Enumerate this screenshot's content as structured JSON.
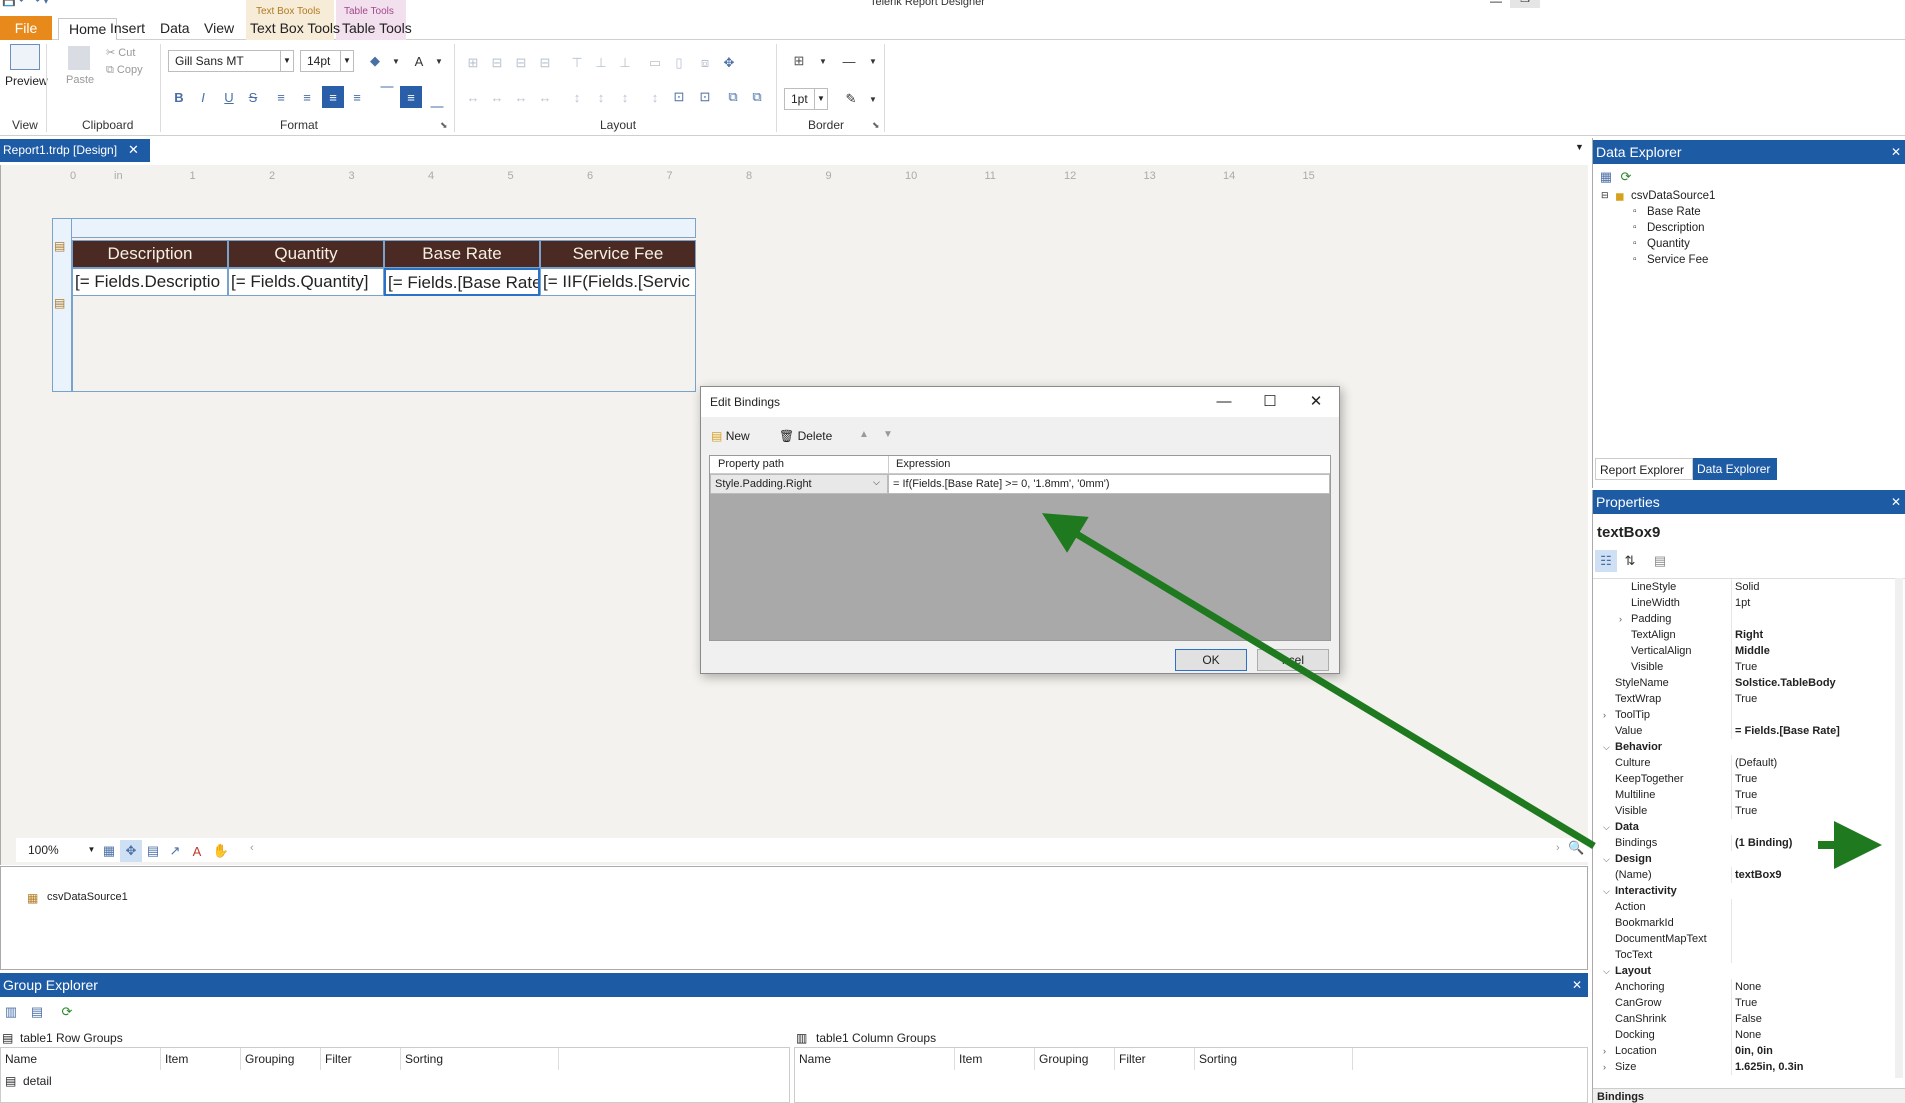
{
  "app": {
    "title": "Telerik Report Designer"
  },
  "ribbon": {
    "tabs": [
      {
        "label": "File"
      },
      {
        "label": "Home"
      },
      {
        "label": "Insert"
      },
      {
        "label": "Data"
      },
      {
        "label": "View"
      },
      {
        "label": "Text Box Tools"
      },
      {
        "label": "Table Tools"
      }
    ],
    "contextual": {
      "textbox_tools": "Text Box Tools",
      "table_tools": "Table Tools"
    },
    "preview_label": "Preview",
    "paste_label": "Paste",
    "cut_label": "Cut",
    "copy_label": "Copy",
    "font_family": "Gill Sans MT",
    "font_size": "14pt",
    "border_width": "1pt",
    "groups": {
      "view": "View",
      "clipboard": "Clipboard",
      "format": "Format",
      "layout": "Layout",
      "border": "Border"
    }
  },
  "document_tab": {
    "label": "Report1.trdp [Design]"
  },
  "ruler": {
    "marks": [
      "0",
      "in",
      "1",
      "2",
      "3",
      "4",
      "5",
      "6",
      "7",
      "8",
      "9",
      "10",
      "11",
      "12",
      "13",
      "14",
      "15"
    ]
  },
  "table": {
    "headers": [
      "Description",
      "Quantity",
      "Base Rate",
      "Service Fee"
    ],
    "cells": [
      "[= Fields.Descriptio",
      "[= Fields.Quantity]",
      "[= Fields.[Base Rate",
      "[= IIF(Fields.[Servic"
    ]
  },
  "design_status": {
    "zoom": "100%"
  },
  "component_tray": {
    "item": "csvDataSource1"
  },
  "group_explorer": {
    "title": "Group Explorer",
    "row_groups_title": "table1 Row Groups",
    "column_groups_title": "table1 Column Groups",
    "columns": [
      "Name",
      "Item",
      "Grouping",
      "Filter",
      "Sorting"
    ],
    "row_items": [
      "detail"
    ]
  },
  "data_explorer": {
    "title": "Data Explorer",
    "datasource": "csvDataSource1",
    "fields": [
      "Base Rate",
      "Description",
      "Quantity",
      "Service Fee"
    ],
    "tabs": [
      "Report Explorer",
      "Data Explorer"
    ]
  },
  "properties": {
    "title": "Properties",
    "object_name": "textBox9",
    "rows": [
      {
        "name": "LineStyle",
        "value": "Solid",
        "indent": 2,
        "bold": false
      },
      {
        "name": "LineWidth",
        "value": "1pt",
        "indent": 2,
        "bold": false
      },
      {
        "name": "Padding",
        "value": "",
        "indent": 2,
        "bold": false,
        "expander": ">"
      },
      {
        "name": "TextAlign",
        "value": "Right",
        "indent": 2,
        "bold": true
      },
      {
        "name": "VerticalAlign",
        "value": "Middle",
        "indent": 2,
        "bold": true
      },
      {
        "name": "Visible",
        "value": "True",
        "indent": 2,
        "bold": false
      },
      {
        "name": "StyleName",
        "value": "Solstice.TableBody",
        "indent": 1,
        "bold": true
      },
      {
        "name": "TextWrap",
        "value": "True",
        "indent": 1,
        "bold": false
      },
      {
        "name": "ToolTip",
        "value": "",
        "indent": 1,
        "bold": false,
        "expander": ">"
      },
      {
        "name": "Value",
        "value": "= Fields.[Base Rate]",
        "indent": 1,
        "bold": true
      },
      {
        "name": "Behavior",
        "value": "",
        "indent": 0,
        "category": true
      },
      {
        "name": "Culture",
        "value": "(Default)",
        "indent": 1,
        "bold": false
      },
      {
        "name": "KeepTogether",
        "value": "True",
        "indent": 1,
        "bold": false
      },
      {
        "name": "Multiline",
        "value": "True",
        "indent": 1,
        "bold": false
      },
      {
        "name": "Visible",
        "value": "True",
        "indent": 1,
        "bold": false
      },
      {
        "name": "Data",
        "value": "",
        "indent": 0,
        "category": true
      },
      {
        "name": "Bindings",
        "value": "(1 Binding)",
        "indent": 1,
        "bold": true
      },
      {
        "name": "Design",
        "value": "",
        "indent": 0,
        "category": true
      },
      {
        "name": "(Name)",
        "value": "textBox9",
        "indent": 1,
        "bold": true
      },
      {
        "name": "Interactivity",
        "value": "",
        "indent": 0,
        "category": true
      },
      {
        "name": "Action",
        "value": "",
        "indent": 1,
        "bold": false
      },
      {
        "name": "BookmarkId",
        "value": "",
        "indent": 1,
        "bold": false
      },
      {
        "name": "DocumentMapText",
        "value": "",
        "indent": 1,
        "bold": false
      },
      {
        "name": "TocText",
        "value": "",
        "indent": 1,
        "bold": false
      },
      {
        "name": "Layout",
        "value": "",
        "indent": 0,
        "category": true
      },
      {
        "name": "Anchoring",
        "value": "None",
        "indent": 1,
        "bold": false
      },
      {
        "name": "CanGrow",
        "value": "True",
        "indent": 1,
        "bold": false
      },
      {
        "name": "CanShrink",
        "value": "False",
        "indent": 1,
        "bold": false
      },
      {
        "name": "Docking",
        "value": "None",
        "indent": 1,
        "bold": false
      },
      {
        "name": "Location",
        "value": "0in, 0in",
        "indent": 1,
        "bold": true,
        "expander": ">"
      },
      {
        "name": "Size",
        "value": "1.625in, 0.3in",
        "indent": 1,
        "bold": true,
        "expander": ">"
      }
    ],
    "footer_label": "Bindings"
  },
  "dialog": {
    "title": "Edit Bindings",
    "new_label": "New",
    "delete_label": "Delete",
    "columns": [
      "Property path",
      "Expression"
    ],
    "binding": {
      "property_path": "Style.Padding.Right",
      "expression": "= If(Fields.[Base Rate] >= 0, '1.8mm', '0mm')"
    },
    "ok_label": "OK",
    "cancel_label": "ncel"
  },
  "colors": {
    "accent": "#1e5ba5",
    "file_tab": "#e8891b",
    "table_header": "#4a2a22",
    "arrow": "#1f7a1f",
    "textbox_ctx": "#f7ecd8",
    "table_ctx": "#f3e0ee"
  }
}
